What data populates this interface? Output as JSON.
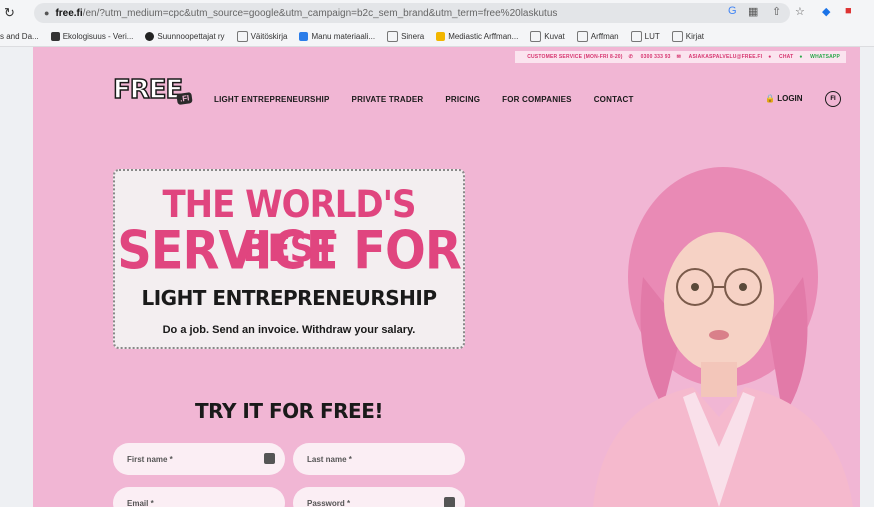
{
  "browser": {
    "url_domain": "free.fi",
    "url_rest": "/en/?utm_medium=cpc&utm_source=google&utm_campaign=b2c_sem_brand&utm_term=free%20laskutus",
    "bookmarks": [
      "s and Da...",
      "Ekologisuus - Veri...",
      "Suunnoopettajat ry",
      "Väitöskirja",
      "Manu materiaali...",
      "Sinera",
      "Mediastic Arffman...",
      "Kuvat",
      "Arffman",
      "LUT",
      "Kirjat"
    ]
  },
  "site": {
    "top_info": {
      "customer_service": "CUSTOMER SERVICE (MON-FRI 8-20)",
      "phone": "0300 333 93",
      "email": "ASIAKASPALVELU@FREE.FI",
      "chat": "CHAT",
      "whatsapp": "WHATSAPP"
    },
    "logo_text": "FREE",
    "logo_sub": ".FI",
    "nav": [
      "LIGHT ENTREPRENEURSHIP",
      "PRIVATE TRADER",
      "PRICING",
      "FOR COMPANIES",
      "CONTACT"
    ],
    "login": "LOGIN",
    "lang": "FI",
    "hero": {
      "line1": "THE WORLD'S BEST",
      "line2": "SERVICE FOR",
      "line3": "LIGHT ENTREPRENEURSHIP",
      "tagline": "Do a job. Send an invoice. Withdraw your salary."
    },
    "cta": "TRY IT FOR FREE!",
    "form": {
      "first_name": "First name *",
      "last_name": "Last name *",
      "email": "Email *",
      "password": "Password *"
    }
  },
  "colors": {
    "brand_pink": "#e0457f",
    "background_pink": "#f1b6d4"
  }
}
